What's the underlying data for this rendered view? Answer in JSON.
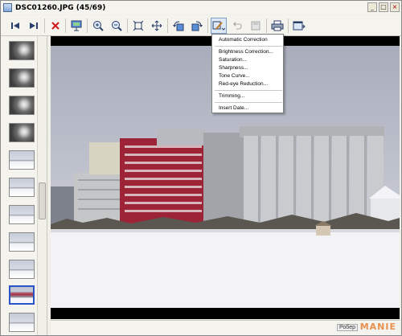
{
  "window": {
    "title": "DSC01260.JPG (45/69)",
    "controls": {
      "minimize": "_",
      "maximize": "□",
      "close": "×"
    }
  },
  "toolbar": {
    "buttons": [
      {
        "name": "first-image",
        "icon": "skip-to-start-icon"
      },
      {
        "name": "last-image",
        "icon": "skip-to-end-icon"
      },
      {
        "name": "delete",
        "icon": "red-x-icon"
      },
      {
        "name": "slideshow",
        "icon": "slideshow-icon"
      },
      {
        "name": "zoom-in",
        "icon": "zoom-in-icon"
      },
      {
        "name": "zoom-out",
        "icon": "zoom-out-icon"
      },
      {
        "name": "fit-window",
        "icon": "fit-window-icon"
      },
      {
        "name": "actual-size",
        "icon": "actual-size-icon"
      },
      {
        "name": "rotate-left",
        "icon": "rotate-left-icon"
      },
      {
        "name": "rotate-right",
        "icon": "rotate-right-icon"
      },
      {
        "name": "image-adjust",
        "icon": "image-adjust-icon"
      },
      {
        "name": "undo",
        "icon": "undo-icon"
      },
      {
        "name": "save",
        "icon": "save-icon"
      },
      {
        "name": "print",
        "icon": "printer-icon"
      },
      {
        "name": "close-viewer",
        "icon": "close-viewer-icon"
      }
    ]
  },
  "menu": {
    "items": [
      "Automatic Correction",
      "Brightness Correction...",
      "Saturation...",
      "Sharpness...",
      "Tone Curve...",
      "Red-eye Reduction...",
      "Trimming...",
      "Insert Date..."
    ]
  },
  "thumbnails": {
    "selected_index": 10,
    "items": [
      "dark",
      "dark",
      "dark",
      "dark",
      "snow",
      "snow",
      "snow",
      "snow",
      "snow",
      "snow",
      "city",
      "snow"
    ]
  },
  "statusbar": {
    "watermark_small": "Робеp",
    "watermark_big": "MANIE"
  },
  "colors": {
    "accent": "#2a55c8",
    "menu_border": "#7f7f7f",
    "photo_letterbox": "#000000"
  }
}
